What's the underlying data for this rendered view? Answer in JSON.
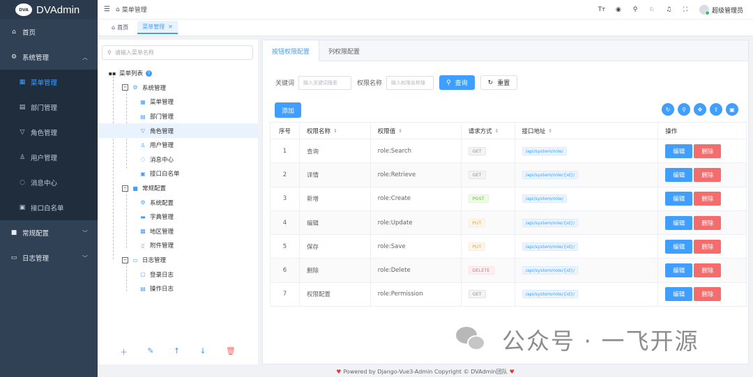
{
  "app": {
    "logo_badge": "DVA",
    "logo_text": "DVAdmin"
  },
  "sidebar": {
    "items": [
      {
        "label": "首页",
        "icon": "home-icon"
      },
      {
        "label": "系统管理",
        "icon": "gear-icon",
        "expanded": true
      },
      {
        "label": "菜单管理",
        "icon": "grid-icon",
        "active": true
      },
      {
        "label": "部门管理",
        "icon": "building-icon"
      },
      {
        "label": "角色管理",
        "icon": "filter-icon"
      },
      {
        "label": "用户管理",
        "icon": "user-icon"
      },
      {
        "label": "消息中心",
        "icon": "message-icon"
      },
      {
        "label": "接口白名单",
        "icon": "list-icon"
      },
      {
        "label": "常规配置",
        "icon": "config-icon"
      },
      {
        "label": "日志管理",
        "icon": "log-icon"
      }
    ]
  },
  "topbar": {
    "breadcrumb": "菜单管理",
    "username": "超级管理员"
  },
  "tags": {
    "home": "首页",
    "current": "菜单管理"
  },
  "tree": {
    "search_placeholder": "请输入菜单名称",
    "root": "菜单列表",
    "nodes": [
      "系统管理",
      "菜单管理",
      "部门管理",
      "角色管理",
      "用户管理",
      "消息中心",
      "接口白名单",
      "常规配置",
      "系统配置",
      "字典管理",
      "地区管理",
      "附件管理",
      "日志管理",
      "登录日志",
      "操作日志"
    ]
  },
  "right": {
    "tabs": [
      "按钮权限配置",
      "列权限配置"
    ],
    "filter": {
      "label1": "关键词",
      "placeholder1": "输入关键词搜索",
      "label2": "权限名称",
      "placeholder2": "输入权限名称搜",
      "query": "查询",
      "reset": "重置"
    },
    "add_label": "添加",
    "columns": [
      "序号",
      "权限名称",
      "权限值",
      "请求方式",
      "接口地址",
      "操作"
    ],
    "rows": [
      {
        "idx": "1",
        "name": "查询",
        "value": "role:Search",
        "method": "GET",
        "api": "/api/system/role/"
      },
      {
        "idx": "2",
        "name": "详情",
        "value": "role:Retrieve",
        "method": "GET",
        "api": "/api/system/role/{id}/"
      },
      {
        "idx": "3",
        "name": "新增",
        "value": "role:Create",
        "method": "POST",
        "api": "/api/system/role/"
      },
      {
        "idx": "4",
        "name": "编辑",
        "value": "role:Update",
        "method": "PUT",
        "api": "/api/system/role/{id}/"
      },
      {
        "idx": "5",
        "name": "保存",
        "value": "role:Save",
        "method": "PUT",
        "api": "/api/system/role/{id}/"
      },
      {
        "idx": "6",
        "name": "删除",
        "value": "role:Delete",
        "method": "DELETE",
        "api": "/api/system/role/{id}/"
      },
      {
        "idx": "7",
        "name": "权限配置",
        "value": "role:Permission",
        "method": "GET",
        "api": "/api/system/role/{id}/"
      }
    ],
    "edit_label": "编辑",
    "delete_label": "删除"
  },
  "watermark": "公众号 · 一飞开源",
  "footer": "Powered by Django-Vue3-Admin Copyright © DVAdmin团队",
  "colors": {
    "primary": "#409eff",
    "danger": "#f56c6c",
    "sidebar_bg": "#304156"
  }
}
